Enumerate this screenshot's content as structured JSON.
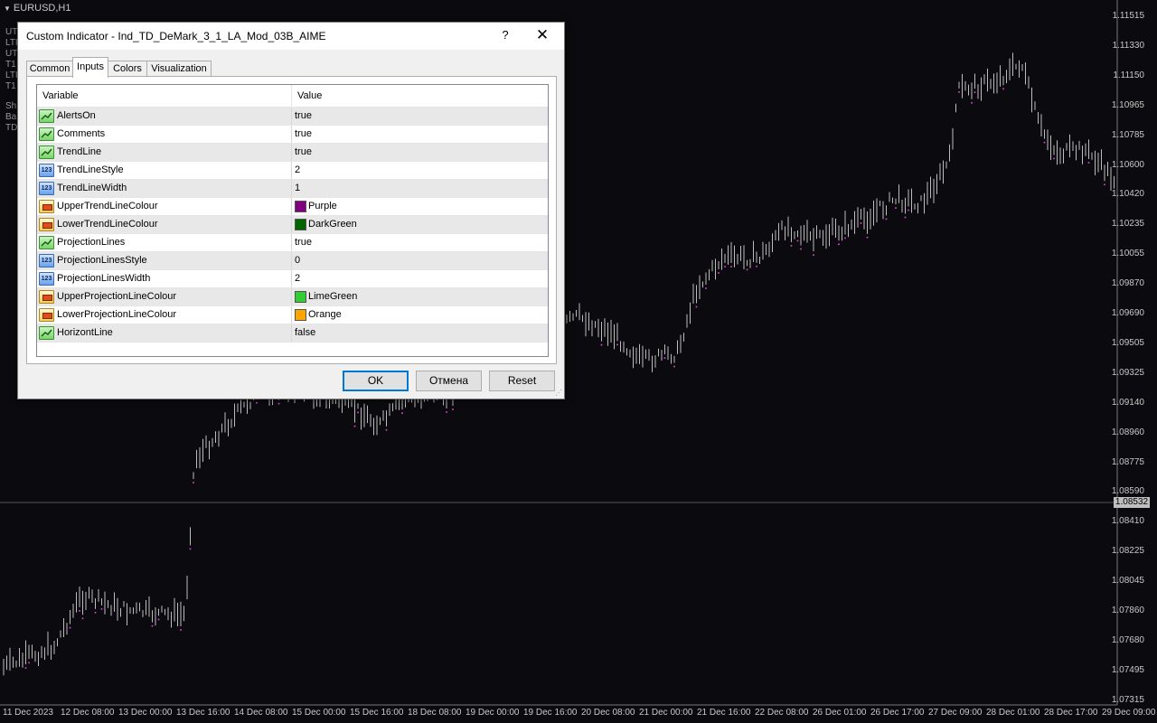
{
  "chart": {
    "symbol": "EURUSD,H1",
    "side_labels": [
      "UT",
      "LTI",
      "UT",
      "T1",
      "LTI",
      "T1",
      "Sh",
      "Ba",
      "TD"
    ],
    "price_axis": [
      "1.11515",
      "1.11330",
      "1.11150",
      "1.10965",
      "1.10785",
      "1.10600",
      "1.10420",
      "1.10235",
      "1.10055",
      "1.09870",
      "1.09690",
      "1.09505",
      "1.09325",
      "1.09140",
      "1.08960",
      "1.08775",
      "1.08590",
      "1.08410",
      "1.08225",
      "1.08045",
      "1.07860",
      "1.07680",
      "1.07495",
      "1.07315"
    ],
    "current_price": "1.08532",
    "time_axis": [
      "11 Dec 2023",
      "12 Dec 08:00",
      "13 Dec 00:00",
      "13 Dec 16:00",
      "14 Dec 08:00",
      "15 Dec 00:00",
      "15 Dec 16:00",
      "18 Dec 08:00",
      "19 Dec 00:00",
      "19 Dec 16:00",
      "20 Dec 08:00",
      "21 Dec 00:00",
      "21 Dec 16:00",
      "22 Dec 08:00",
      "26 Dec 01:00",
      "26 Dec 17:00",
      "27 Dec 09:00",
      "28 Dec 01:00",
      "28 Dec 17:00",
      "29 Dec 09:00"
    ],
    "colors": {
      "background": "#0b0b0f",
      "bars": "#bdbdbd",
      "signal": "#d43ad4"
    }
  },
  "dialog": {
    "title": "Custom Indicator - Ind_TD_DeMark_3_1_LA_Mod_03B_AIME",
    "help_glyph": "?",
    "close_glyph": "✕",
    "tabs": [
      {
        "label": "Common",
        "active": false
      },
      {
        "label": "Inputs",
        "active": true
      },
      {
        "label": "Colors",
        "active": false
      },
      {
        "label": "Visualization",
        "active": false
      }
    ],
    "columns": {
      "variable": "Variable",
      "value": "Value"
    },
    "rows": [
      {
        "type": "bool",
        "name": "AlertsOn",
        "value": "true"
      },
      {
        "type": "bool",
        "name": "Comments",
        "value": "true"
      },
      {
        "type": "bool",
        "name": "TrendLine",
        "value": "true"
      },
      {
        "type": "int",
        "name": "TrendLineStyle",
        "value": "2"
      },
      {
        "type": "int",
        "name": "TrendLineWidth",
        "value": "1"
      },
      {
        "type": "color",
        "name": "UpperTrendLineColour",
        "value": "Purple",
        "swatch": "#800080"
      },
      {
        "type": "color",
        "name": "LowerTrendLineColour",
        "value": "DarkGreen",
        "swatch": "#006400"
      },
      {
        "type": "bool",
        "name": "ProjectionLines",
        "value": "true"
      },
      {
        "type": "int",
        "name": "ProjectionLinesStyle",
        "value": "0"
      },
      {
        "type": "int",
        "name": "ProjectionLinesWidth",
        "value": "2"
      },
      {
        "type": "color",
        "name": "UpperProjectionLineColour",
        "value": "LimeGreen",
        "swatch": "#32cd32"
      },
      {
        "type": "color",
        "name": "LowerProjectionLineColour",
        "value": "Orange",
        "swatch": "#ffa500"
      },
      {
        "type": "bool",
        "name": "HorizontLine",
        "value": "false"
      }
    ],
    "buttons": {
      "ok": "OK",
      "cancel": "Отмена",
      "reset": "Reset"
    }
  }
}
